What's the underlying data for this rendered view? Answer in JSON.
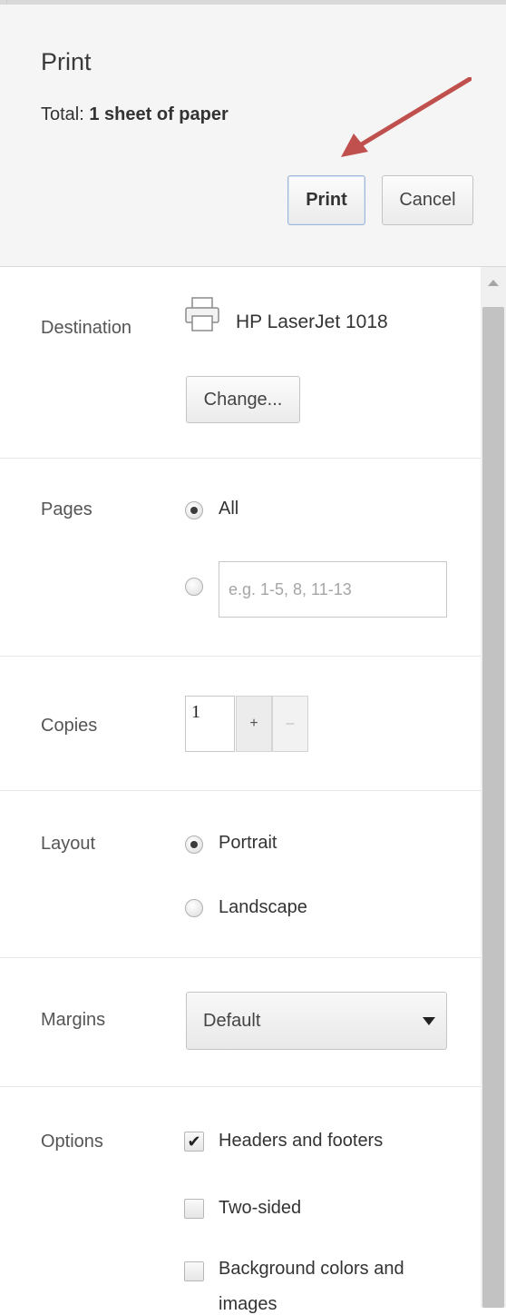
{
  "header": {
    "title": "Print",
    "summary_prefix": "Total:",
    "summary_value": "1 sheet of paper",
    "print_label": "Print",
    "cancel_label": "Cancel"
  },
  "destination": {
    "label": "Destination",
    "printer_icon": "printer-icon",
    "printer_name": "HP LaserJet 1018",
    "change_label": "Change..."
  },
  "pages": {
    "label": "Pages",
    "all_label": "All",
    "all_selected": true,
    "range_placeholder": "e.g. 1-5, 8, 11-13"
  },
  "copies": {
    "label": "Copies",
    "value": "1",
    "plus": "+",
    "minus": "–"
  },
  "layout": {
    "label": "Layout",
    "portrait_label": "Portrait",
    "landscape_label": "Landscape",
    "selected": "Portrait"
  },
  "margins": {
    "label": "Margins",
    "value": "Default"
  },
  "options": {
    "label": "Options",
    "items": [
      {
        "label": "Headers and footers",
        "checked": true
      },
      {
        "label": "Two-sided",
        "checked": false
      },
      {
        "label": "Background colors and",
        "checked": false
      },
      {
        "label": "images"
      }
    ]
  },
  "colors": {
    "arrow": "#c0504d",
    "header_bg": "#f5f5f5",
    "print_button_border": "#9fb8d8"
  }
}
